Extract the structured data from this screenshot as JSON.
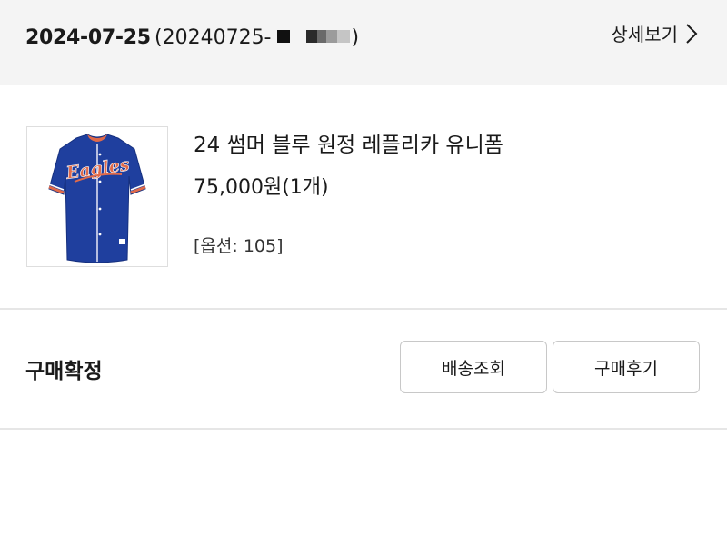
{
  "header": {
    "order_date": "2024-07-25",
    "order_number_prefix": "(20240725-",
    "order_number_suffix": ")",
    "detail_label": "상세보기",
    "detail_icon": "chevron-right-icon"
  },
  "product": {
    "image_icon": "jersey-image",
    "jersey_wordmark": "Eagles",
    "name": "24 썸머 블루 원정 레플리카 유니폼",
    "price": "75,000원(1개)",
    "option": "[옵션: 105]"
  },
  "status": {
    "label": "구매확정",
    "track_button": "배송조회",
    "review_button": "구매후기"
  },
  "colors": {
    "header_bg": "#f4f4f4",
    "jersey_blue": "#1f3f9e",
    "jersey_accent": "#e06a4a"
  }
}
